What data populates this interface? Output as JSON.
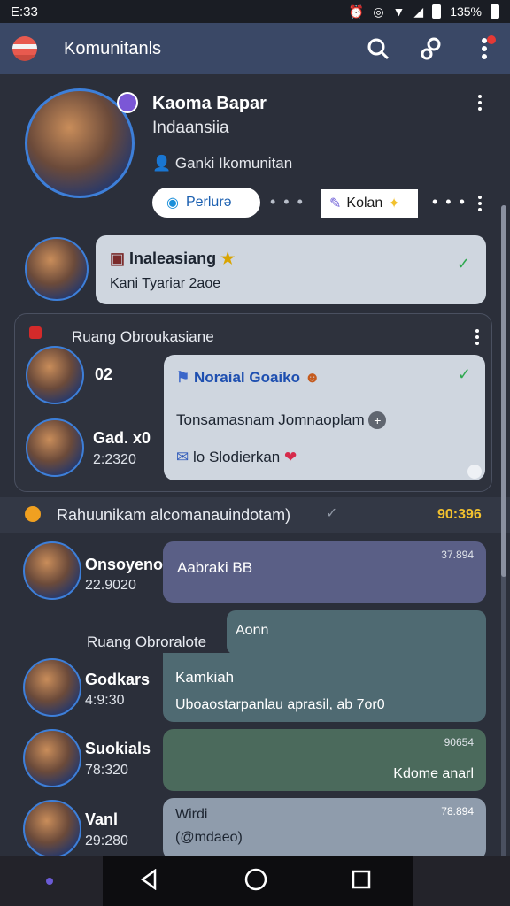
{
  "status": {
    "time": "E:33",
    "battery": "135%"
  },
  "app": {
    "title": "Komunitanls"
  },
  "profile": {
    "name": "Kaoma Bapar",
    "subtitle": "Indaansiia",
    "link_label": "Ganki Ikomunitan",
    "pill_primary": "Perlurə",
    "pill_secondary": "Kolan"
  },
  "pinned": {
    "title": "Inaleasiang",
    "subtitle": "Kani Tyariar 2aoe"
  },
  "card": {
    "title": "Ruang Obroukasiane",
    "member1_name": "02",
    "member2_name": "Gad. x0",
    "member2_time": "2:2320",
    "msg_title": "Noraial Goaiko",
    "msg_body": "Tonsamasnam Jomnaoplam",
    "msg_footer": "lo Slodierkan"
  },
  "section": {
    "label": "Rahuunikam alcomanauindotam)",
    "time": "90:396"
  },
  "messages": [
    {
      "name": "Onsoyeno",
      "time": "22.9020",
      "text": "Aabraki BB",
      "stamp": "37.894"
    },
    {
      "label": "Ruang Obroralote",
      "reply": "Aonn"
    },
    {
      "name": "Godkars",
      "time": "4:9:30",
      "text": "Kamkiah",
      "text2": "Uboaostarpanlau aprasil,",
      "text3": "ab",
      "text4": "7or0"
    },
    {
      "name": "Suokials",
      "time": "78:320",
      "text": "Kdome anarl",
      "stamp": "90654"
    },
    {
      "name": "Vanl",
      "time": "29:280",
      "text": "Wirdi",
      "text2": "(@mdaeo)",
      "stamp": "78.894"
    }
  ],
  "colors": {
    "appbar": "#3a4866",
    "background": "#2b2f3a",
    "accent": "#3d7fd9"
  }
}
